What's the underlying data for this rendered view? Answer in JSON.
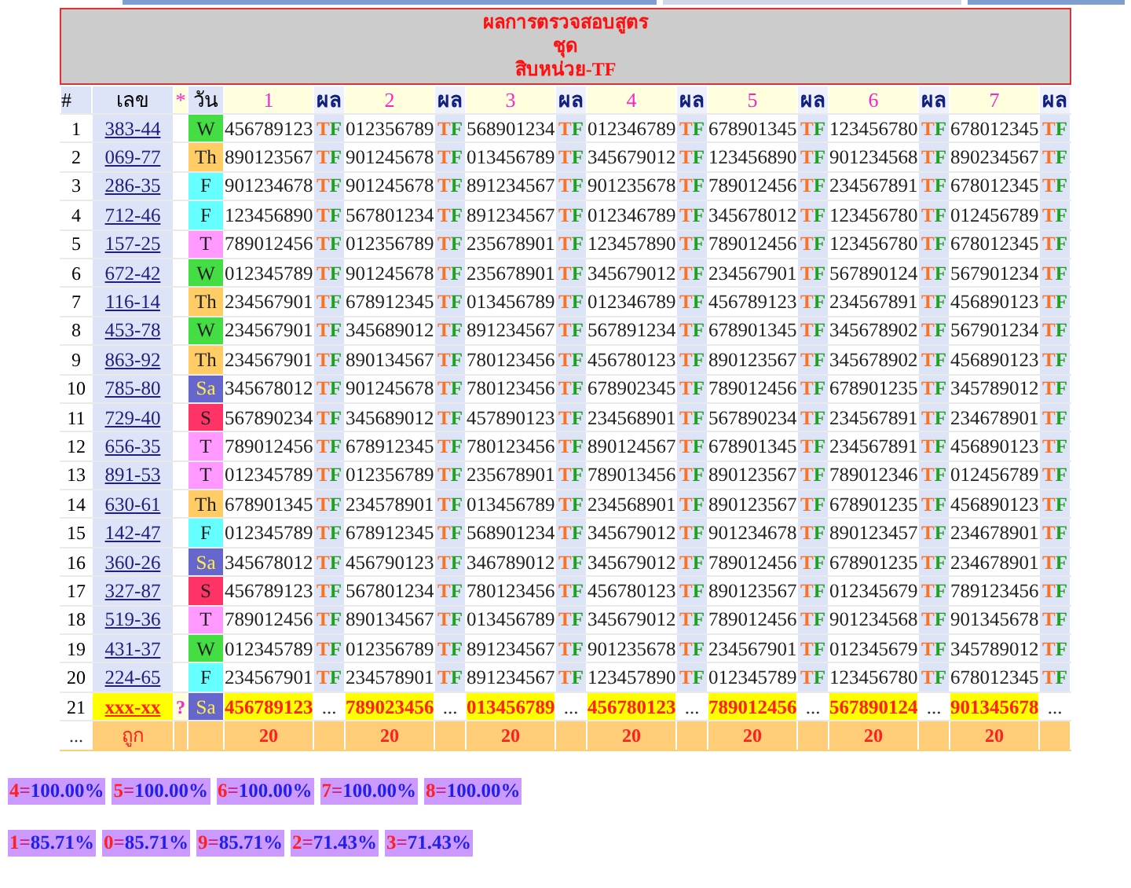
{
  "title": [
    "ผลการตรวจสอบสูตร",
    "ชุด",
    "สิบหน่วย-TF"
  ],
  "header": {
    "index": "#",
    "number": "เลข",
    "mark": "*",
    "day": "วัน",
    "columns": [
      {
        "label": "1",
        "result": "ผล"
      },
      {
        "label": "2",
        "result": "ผล"
      },
      {
        "label": "3",
        "result": "ผล"
      },
      {
        "label": "4",
        "result": "ผล"
      },
      {
        "label": "5",
        "result": "ผล"
      },
      {
        "label": "6",
        "result": "ผล"
      },
      {
        "label": "7",
        "result": "ผล"
      }
    ]
  },
  "rows": [
    {
      "kind": "past",
      "index": "1",
      "number": "383-44",
      "day": "W",
      "color": "#44dd44",
      "cells": [
        {
          "value": "456789123",
          "result": "TF"
        },
        {
          "value": "012356789",
          "result": "TF"
        },
        {
          "value": "568901234",
          "result": "TF"
        },
        {
          "value": "012346789",
          "result": "TF"
        },
        {
          "value": "678901345",
          "result": "TF"
        },
        {
          "value": "123456780",
          "result": "TF"
        },
        {
          "value": "678012345",
          "result": "TF"
        }
      ]
    },
    {
      "kind": "past",
      "index": "2",
      "number": "069-77",
      "day": "Th",
      "color": "#ffcc66",
      "cells": [
        {
          "value": "890123567",
          "result": "TF"
        },
        {
          "value": "901245678",
          "result": "TF"
        },
        {
          "value": "013456789",
          "result": "TF"
        },
        {
          "value": "345679012",
          "result": "TF"
        },
        {
          "value": "123456890",
          "result": "TF"
        },
        {
          "value": "901234568",
          "result": "TF"
        },
        {
          "value": "890234567",
          "result": "TF"
        }
      ]
    },
    {
      "kind": "past",
      "index": "3",
      "number": "286-35",
      "day": "F",
      "color": "#66ffff",
      "cells": [
        {
          "value": "901234678",
          "result": "TF"
        },
        {
          "value": "901245678",
          "result": "TF"
        },
        {
          "value": "891234567",
          "result": "TF"
        },
        {
          "value": "901235678",
          "result": "TF"
        },
        {
          "value": "789012456",
          "result": "TF"
        },
        {
          "value": "234567891",
          "result": "TF"
        },
        {
          "value": "678012345",
          "result": "TF"
        }
      ]
    },
    {
      "kind": "past",
      "index": "4",
      "number": "712-46",
      "day": "F",
      "color": "#66ffff",
      "cells": [
        {
          "value": "123456890",
          "result": "TF"
        },
        {
          "value": "567801234",
          "result": "TF"
        },
        {
          "value": "891234567",
          "result": "TF"
        },
        {
          "value": "012346789",
          "result": "TF"
        },
        {
          "value": "345678012",
          "result": "TF"
        },
        {
          "value": "123456780",
          "result": "TF"
        },
        {
          "value": "012456789",
          "result": "TF"
        }
      ]
    },
    {
      "kind": "past",
      "index": "5",
      "number": "157-25",
      "day": "T",
      "color": "#ff99ff",
      "cells": [
        {
          "value": "789012456",
          "result": "TF"
        },
        {
          "value": "012356789",
          "result": "TF"
        },
        {
          "value": "235678901",
          "result": "TF"
        },
        {
          "value": "123457890",
          "result": "TF"
        },
        {
          "value": "789012456",
          "result": "TF"
        },
        {
          "value": "123456780",
          "result": "TF"
        },
        {
          "value": "678012345",
          "result": "TF"
        }
      ]
    },
    {
      "kind": "past",
      "index": "6",
      "number": "672-42",
      "day": "W",
      "color": "#44dd44",
      "cells": [
        {
          "value": "012345789",
          "result": "TF"
        },
        {
          "value": "901245678",
          "result": "TF"
        },
        {
          "value": "235678901",
          "result": "TF"
        },
        {
          "value": "345679012",
          "result": "TF"
        },
        {
          "value": "234567901",
          "result": "TF"
        },
        {
          "value": "567890124",
          "result": "TF"
        },
        {
          "value": "567901234",
          "result": "TF"
        }
      ]
    },
    {
      "kind": "past",
      "index": "7",
      "number": "116-14",
      "day": "Th",
      "color": "#ffcc66",
      "cells": [
        {
          "value": "234567901",
          "result": "TF"
        },
        {
          "value": "678912345",
          "result": "TF"
        },
        {
          "value": "013456789",
          "result": "TF"
        },
        {
          "value": "012346789",
          "result": "TF"
        },
        {
          "value": "456789123",
          "result": "TF"
        },
        {
          "value": "234567891",
          "result": "TF"
        },
        {
          "value": "456890123",
          "result": "TF"
        }
      ]
    },
    {
      "kind": "past",
      "index": "8",
      "number": "453-78",
      "day": "W",
      "color": "#44dd44",
      "cells": [
        {
          "value": "234567901",
          "result": "TF"
        },
        {
          "value": "345689012",
          "result": "TF"
        },
        {
          "value": "891234567",
          "result": "TF"
        },
        {
          "value": "567891234",
          "result": "TF"
        },
        {
          "value": "678901345",
          "result": "TF"
        },
        {
          "value": "345678902",
          "result": "TF"
        },
        {
          "value": "567901234",
          "result": "TF"
        }
      ]
    },
    {
      "kind": "past",
      "index": "9",
      "number": "863-92",
      "day": "Th",
      "color": "#ffcc66",
      "cells": [
        {
          "value": "234567901",
          "result": "TF"
        },
        {
          "value": "890134567",
          "result": "TF"
        },
        {
          "value": "780123456",
          "result": "TF"
        },
        {
          "value": "456780123",
          "result": "TF"
        },
        {
          "value": "890123567",
          "result": "TF"
        },
        {
          "value": "345678902",
          "result": "TF"
        },
        {
          "value": "456890123",
          "result": "TF"
        }
      ]
    },
    {
      "kind": "past",
      "index": "10",
      "number": "785-80",
      "day": "Sa",
      "color": "#6666cc",
      "cells": [
        {
          "value": "345678012",
          "result": "TF"
        },
        {
          "value": "901245678",
          "result": "TF"
        },
        {
          "value": "780123456",
          "result": "TF"
        },
        {
          "value": "678902345",
          "result": "TF"
        },
        {
          "value": "789012456",
          "result": "TF"
        },
        {
          "value": "678901235",
          "result": "TF"
        },
        {
          "value": "345789012",
          "result": "TF"
        }
      ]
    },
    {
      "kind": "past",
      "index": "11",
      "number": "729-40",
      "day": "S",
      "color": "#ff3366",
      "cells": [
        {
          "value": "567890234",
          "result": "TF"
        },
        {
          "value": "345689012",
          "result": "TF"
        },
        {
          "value": "457890123",
          "result": "TF"
        },
        {
          "value": "234568901",
          "result": "TF"
        },
        {
          "value": "567890234",
          "result": "TF"
        },
        {
          "value": "234567891",
          "result": "TF"
        },
        {
          "value": "234678901",
          "result": "TF"
        }
      ]
    },
    {
      "kind": "past",
      "index": "12",
      "number": "656-35",
      "day": "T",
      "color": "#ff99ff",
      "cells": [
        {
          "value": "789012456",
          "result": "TF"
        },
        {
          "value": "678912345",
          "result": "TF"
        },
        {
          "value": "780123456",
          "result": "TF"
        },
        {
          "value": "890124567",
          "result": "TF"
        },
        {
          "value": "678901345",
          "result": "TF"
        },
        {
          "value": "234567891",
          "result": "TF"
        },
        {
          "value": "456890123",
          "result": "TF"
        }
      ]
    },
    {
      "kind": "past",
      "index": "13",
      "number": "891-53",
      "day": "T",
      "color": "#ff99ff",
      "cells": [
        {
          "value": "012345789",
          "result": "TF"
        },
        {
          "value": "012356789",
          "result": "TF"
        },
        {
          "value": "235678901",
          "result": "TF"
        },
        {
          "value": "789013456",
          "result": "TF"
        },
        {
          "value": "890123567",
          "result": "TF"
        },
        {
          "value": "789012346",
          "result": "TF"
        },
        {
          "value": "012456789",
          "result": "TF"
        }
      ]
    },
    {
      "kind": "past",
      "index": "14",
      "number": "630-61",
      "day": "Th",
      "color": "#ffcc66",
      "cells": [
        {
          "value": "678901345",
          "result": "TF"
        },
        {
          "value": "234578901",
          "result": "TF"
        },
        {
          "value": "013456789",
          "result": "TF"
        },
        {
          "value": "234568901",
          "result": "TF"
        },
        {
          "value": "890123567",
          "result": "TF"
        },
        {
          "value": "678901235",
          "result": "TF"
        },
        {
          "value": "456890123",
          "result": "TF"
        }
      ]
    },
    {
      "kind": "past",
      "index": "15",
      "number": "142-47",
      "day": "F",
      "color": "#66ffff",
      "cells": [
        {
          "value": "012345789",
          "result": "TF"
        },
        {
          "value": "678912345",
          "result": "TF"
        },
        {
          "value": "568901234",
          "result": "TF"
        },
        {
          "value": "345679012",
          "result": "TF"
        },
        {
          "value": "901234678",
          "result": "TF"
        },
        {
          "value": "890123457",
          "result": "TF"
        },
        {
          "value": "234678901",
          "result": "TF"
        }
      ]
    },
    {
      "kind": "past",
      "index": "16",
      "number": "360-26",
      "day": "Sa",
      "color": "#6666cc",
      "cells": [
        {
          "value": "345678012",
          "result": "TF"
        },
        {
          "value": "456790123",
          "result": "TF"
        },
        {
          "value": "346789012",
          "result": "TF"
        },
        {
          "value": "345679012",
          "result": "TF"
        },
        {
          "value": "789012456",
          "result": "TF"
        },
        {
          "value": "678901235",
          "result": "TF"
        },
        {
          "value": "234678901",
          "result": "TF"
        }
      ]
    },
    {
      "kind": "past",
      "index": "17",
      "number": "327-87",
      "day": "S",
      "color": "#ff3366",
      "cells": [
        {
          "value": "456789123",
          "result": "TF"
        },
        {
          "value": "567801234",
          "result": "TF"
        },
        {
          "value": "780123456",
          "result": "TF"
        },
        {
          "value": "456780123",
          "result": "TF"
        },
        {
          "value": "890123567",
          "result": "TF"
        },
        {
          "value": "012345679",
          "result": "TF"
        },
        {
          "value": "789123456",
          "result": "TF"
        }
      ]
    },
    {
      "kind": "past",
      "index": "18",
      "number": "519-36",
      "day": "T",
      "color": "#ff99ff",
      "cells": [
        {
          "value": "789012456",
          "result": "TF"
        },
        {
          "value": "890134567",
          "result": "TF"
        },
        {
          "value": "013456789",
          "result": "TF"
        },
        {
          "value": "345679012",
          "result": "TF"
        },
        {
          "value": "789012456",
          "result": "TF"
        },
        {
          "value": "901234568",
          "result": "TF"
        },
        {
          "value": "901345678",
          "result": "TF"
        }
      ]
    },
    {
      "kind": "past",
      "index": "19",
      "number": "431-37",
      "day": "W",
      "color": "#44dd44",
      "cells": [
        {
          "value": "012345789",
          "result": "TF"
        },
        {
          "value": "012356789",
          "result": "TF"
        },
        {
          "value": "891234567",
          "result": "TF"
        },
        {
          "value": "901235678",
          "result": "TF"
        },
        {
          "value": "234567901",
          "result": "TF"
        },
        {
          "value": "012345679",
          "result": "TF"
        },
        {
          "value": "345789012",
          "result": "TF"
        }
      ]
    },
    {
      "kind": "past",
      "index": "20",
      "number": "224-65",
      "day": "F",
      "color": "#66ffff",
      "cells": [
        {
          "value": "234567901",
          "result": "TF"
        },
        {
          "value": "234578901",
          "result": "TF"
        },
        {
          "value": "891234567",
          "result": "TF"
        },
        {
          "value": "123457890",
          "result": "TF"
        },
        {
          "value": "012345789",
          "result": "TF"
        },
        {
          "value": "123456780",
          "result": "TF"
        },
        {
          "value": "678012345",
          "result": "TF"
        }
      ]
    },
    {
      "kind": "next",
      "index": "21",
      "number": "xxx-xx",
      "mark": "?",
      "day": "Sa",
      "color": "#6666cc",
      "cells": [
        {
          "value": "456789123",
          "result": "..."
        },
        {
          "value": "789023456",
          "result": "..."
        },
        {
          "value": "013456789",
          "result": "..."
        },
        {
          "value": "456780123",
          "result": "..."
        },
        {
          "value": "789012456",
          "result": "..."
        },
        {
          "value": "567890124",
          "result": "..."
        },
        {
          "value": "901345678",
          "result": "..."
        }
      ]
    }
  ],
  "footer": {
    "index": "...",
    "label": "ถูก",
    "counts": [
      "20",
      "20",
      "20",
      "20",
      "20",
      "20",
      "20"
    ]
  },
  "percent_rows": [
    [
      {
        "digit": "4",
        "sep": "=",
        "percent": "100.00%"
      },
      {
        "digit": "5",
        "sep": "=",
        "percent": "100.00%"
      },
      {
        "digit": "6",
        "sep": "=",
        "percent": "100.00%"
      },
      {
        "digit": "7",
        "sep": "=",
        "percent": "100.00%"
      },
      {
        "digit": "8",
        "sep": "=",
        "percent": "100.00%"
      }
    ],
    [
      {
        "digit": "1",
        "sep": "=",
        "percent": "85.71%"
      },
      {
        "digit": "0",
        "sep": "=",
        "percent": "85.71%"
      },
      {
        "digit": "9",
        "sep": "=",
        "percent": "85.71%"
      },
      {
        "digit": "2",
        "sep": "=",
        "percent": "71.43%"
      },
      {
        "digit": "3",
        "sep": "=",
        "percent": "71.43%"
      }
    ]
  ]
}
